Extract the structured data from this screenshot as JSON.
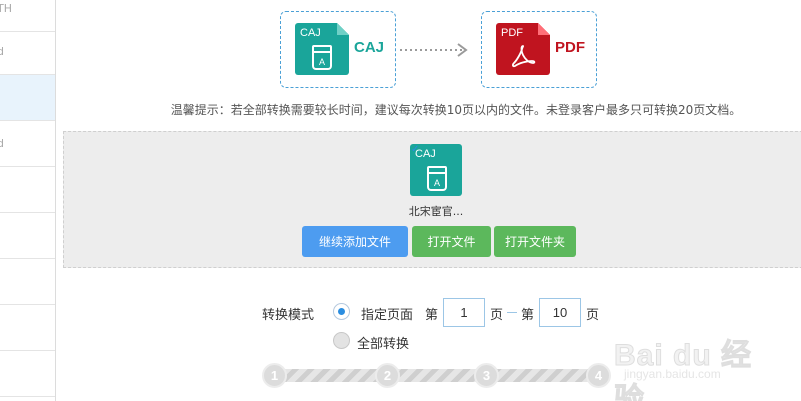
{
  "sidebar": {
    "items": [
      {
        "label": "TH"
      },
      {
        "label": "d"
      },
      {
        "label": ""
      },
      {
        "label": "d"
      },
      {
        "label": ""
      },
      {
        "label": ""
      },
      {
        "label": ""
      },
      {
        "label": ""
      },
      {
        "label": ""
      }
    ],
    "active_index": 2
  },
  "conversion": {
    "source": {
      "icon_tag": "CAJ",
      "label": "CAJ",
      "icon": "caj-file-icon",
      "color": "#1aa59a"
    },
    "target": {
      "icon_tag": "PDF",
      "label": "PDF",
      "icon": "pdf-file-icon",
      "color": "#c0141f"
    },
    "arrow_icon": "dotted-arrow-right-icon"
  },
  "tip": "温馨提示：若全部转换需要较长时间，建议每次转换10页以内的文件。未登录客户最多只可转换20页文档。",
  "upload_panel": {
    "file": {
      "icon_tag": "CAJ",
      "book_letter": "A",
      "name": "北宋宦官..."
    },
    "buttons": {
      "add_more": "继续添加文件",
      "open_file": "打开文件",
      "open_folder": "打开文件夹"
    }
  },
  "mode": {
    "label": "转换模式",
    "option_range": "指定页面",
    "option_all": "全部转换",
    "selected": "range",
    "page_prefix": "第",
    "page_suffix": "页",
    "from_page": "1",
    "to_page": "10"
  },
  "steps": [
    "1",
    "2",
    "3",
    "4"
  ],
  "watermark": {
    "main": "Bai du 经验",
    "sub": "jingyan.baidu.com"
  },
  "colors": {
    "accent_blue": "#4d9cf0",
    "button_green": "#5cb85c",
    "caj_teal": "#1aa59a",
    "pdf_red": "#c0141f",
    "dashed_border": "#4aa0d6"
  }
}
